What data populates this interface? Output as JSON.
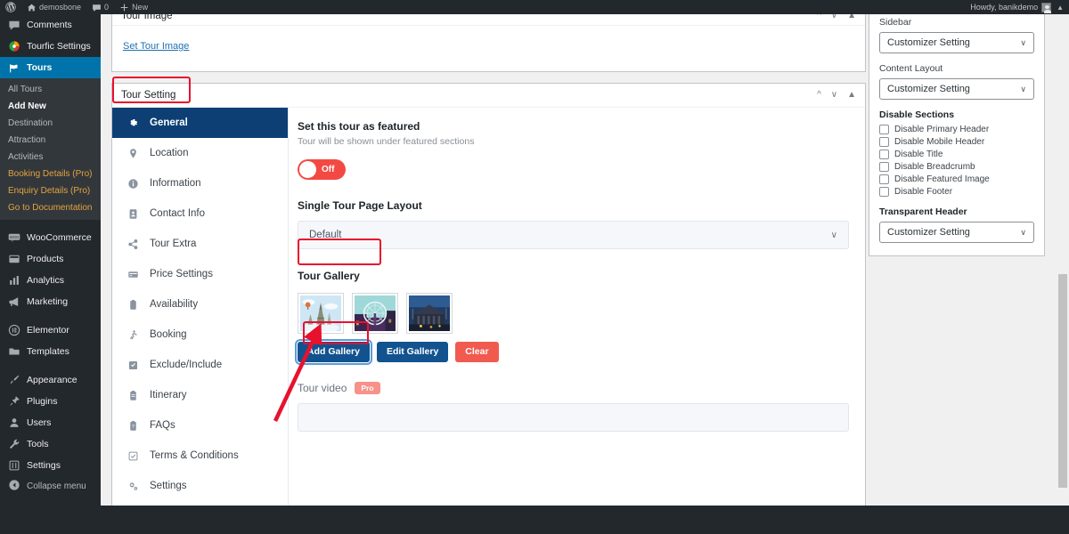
{
  "adminbar": {
    "wp_logo_icon": "wordpress-logo-icon",
    "site_icon": "home-icon",
    "site_name": "demosbone",
    "comments_icon": "comment-bubble-icon",
    "comments_count": "0",
    "new_icon": "plus-icon",
    "new_label": "New",
    "howdy": "Howdy, banikdemo",
    "avatar_icon": "user-avatar-icon",
    "collapse_caret": "▲"
  },
  "adminmenu": {
    "items": [
      {
        "label": "Comments",
        "icon": "comment-bubble-icon",
        "current": false
      },
      {
        "label": "Tourfic Settings",
        "icon": "tourfic-logo-icon",
        "current": false
      },
      {
        "label": "Tours",
        "icon": "tours-flag-icon",
        "current": true
      }
    ],
    "submenu": [
      {
        "label": "All Tours",
        "state": "normal"
      },
      {
        "label": "Add New",
        "state": "current"
      },
      {
        "label": "Destination",
        "state": "normal"
      },
      {
        "label": "Attraction",
        "state": "normal"
      },
      {
        "label": "Activities",
        "state": "normal"
      },
      {
        "label": "Booking Details (Pro)",
        "state": "pro"
      },
      {
        "label": "Enquiry Details (Pro)",
        "state": "pro"
      },
      {
        "label": "Go to Documentation",
        "state": "pro"
      }
    ],
    "items2": [
      {
        "label": "WooCommerce",
        "icon": "woocommerce-icon"
      },
      {
        "label": "Products",
        "icon": "products-icon"
      },
      {
        "label": "Analytics",
        "icon": "analytics-bars-icon"
      },
      {
        "label": "Marketing",
        "icon": "megaphone-icon"
      }
    ],
    "items3": [
      {
        "label": "Elementor",
        "icon": "elementor-icon"
      },
      {
        "label": "Templates",
        "icon": "folder-icon"
      }
    ],
    "items4": [
      {
        "label": "Appearance",
        "icon": "paintbrush-icon"
      },
      {
        "label": "Plugins",
        "icon": "plug-icon"
      },
      {
        "label": "Users",
        "icon": "user-icon"
      },
      {
        "label": "Tools",
        "icon": "wrench-icon"
      },
      {
        "label": "Settings",
        "icon": "sliders-icon"
      }
    ],
    "collapse": {
      "label": "Collapse menu",
      "icon": "collapse-arrow-icon"
    }
  },
  "tour_image_box": {
    "title": "Tour Image",
    "set_image_link": "Set Tour Image",
    "move_up_icon": "chevron-up-icon",
    "move_down_icon": "chevron-down-icon",
    "toggle_icon": "panel-toggle-icon"
  },
  "tour_setting_box": {
    "title": "Tour Setting",
    "move_up_icon": "chevron-up-icon",
    "move_down_icon": "chevron-down-icon",
    "toggle_icon": "panel-toggle-icon",
    "tabs": [
      {
        "label": "General",
        "icon": "gear-icon",
        "active": true
      },
      {
        "label": "Location",
        "icon": "map-pin-icon",
        "active": false
      },
      {
        "label": "Information",
        "icon": "info-circle-icon",
        "active": false
      },
      {
        "label": "Contact Info",
        "icon": "contact-card-icon",
        "active": false
      },
      {
        "label": "Tour Extra",
        "icon": "share-nodes-icon",
        "active": false
      },
      {
        "label": "Price Settings",
        "icon": "credit-card-icon",
        "active": false
      },
      {
        "label": "Availability",
        "icon": "clipboard-icon",
        "active": false
      },
      {
        "label": "Booking",
        "icon": "hiker-icon",
        "active": false
      },
      {
        "label": "Exclude/Include",
        "icon": "checkbox-icon",
        "active": false
      },
      {
        "label": "Itinerary",
        "icon": "clipboard-list-icon",
        "active": false
      },
      {
        "label": "FAQs",
        "icon": "clipboard-question-icon",
        "active": false
      },
      {
        "label": "Terms & Conditions",
        "icon": "check-square-icon",
        "active": false
      },
      {
        "label": "Settings",
        "icon": "gears-icon",
        "active": false
      }
    ],
    "featured": {
      "title": "Set this tour as featured",
      "description": "Tour will be shown under featured sections",
      "toggle_state": "Off"
    },
    "layout": {
      "label": "Single Tour Page Layout",
      "value": "Default",
      "caret_icon": "chevron-down-icon"
    },
    "gallery": {
      "label": "Tour Gallery",
      "thumbnails": [
        {
          "alt": "eiffel-tower-thumbnail"
        },
        {
          "alt": "london-eye-thumbnail"
        },
        {
          "alt": "city-square-thumbnail"
        }
      ],
      "add_button": "Add Gallery",
      "edit_button": "Edit Gallery",
      "clear_button": "Clear"
    },
    "tour_video": {
      "label": "Tour video",
      "badge": "Pro",
      "input_value": "",
      "input_placeholder": ""
    }
  },
  "sidebar_panel": {
    "sidebar": {
      "label": "Sidebar",
      "value": "Customizer Setting",
      "caret_icon": "chevron-down-icon"
    },
    "content_layout": {
      "label": "Content Layout",
      "value": "Customizer Setting",
      "caret_icon": "chevron-down-icon"
    },
    "disable_sections": {
      "label": "Disable Sections",
      "options": [
        {
          "label": "Disable Primary Header",
          "checked": false
        },
        {
          "label": "Disable Mobile Header",
          "checked": false
        },
        {
          "label": "Disable Title",
          "checked": false
        },
        {
          "label": "Disable Breadcrumb",
          "checked": false
        },
        {
          "label": "Disable Featured Image",
          "checked": false
        },
        {
          "label": "Disable Footer",
          "checked": false
        }
      ]
    },
    "transparent_header": {
      "label": "Transparent Header",
      "value": "Customizer Setting",
      "caret_icon": "chevron-down-icon"
    }
  },
  "annotations": {
    "highlight_color": "#e8112d",
    "boxes": [
      {
        "name": "tour-setting-title-highlight"
      },
      {
        "name": "tour-gallery-title-highlight"
      },
      {
        "name": "add-gallery-button-highlight"
      }
    ],
    "arrow": {
      "name": "add-gallery-pointer-arrow"
    }
  },
  "colors": {
    "admin_dark": "#23282d",
    "admin_submenu": "#32373c",
    "admin_current": "#0073aa",
    "tab_active": "#0d3f74",
    "btn_blue": "#12538f",
    "btn_red": "#f05a4f",
    "toggle_off": "#f24a43",
    "pro_badge": "#f7918a",
    "link": "#2271b1"
  }
}
